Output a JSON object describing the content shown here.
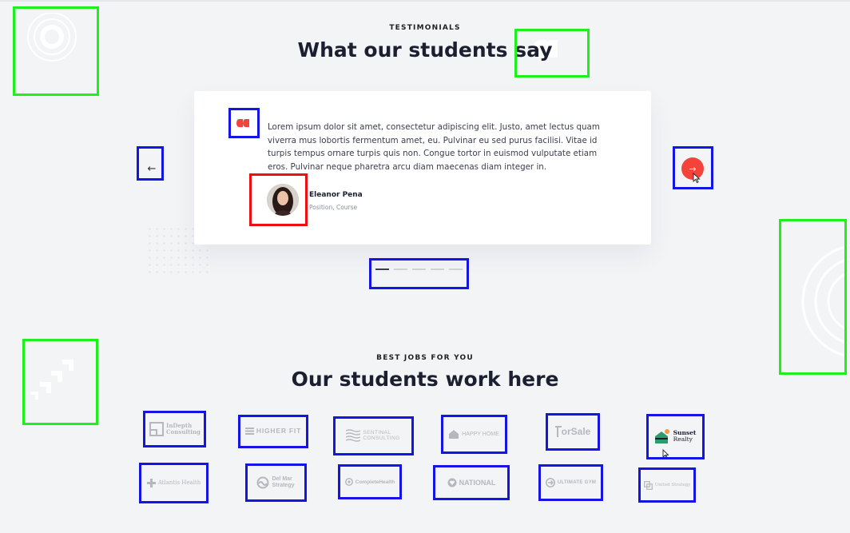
{
  "testimonials": {
    "eyebrow": "TESTIMONIALS",
    "heading": "What our students say",
    "quote": "Lorem ipsum dolor sit amet, consectetur adipiscing elit. Justo, amet lectus quam viverra mus lobortis fermentum amet, eu. Pulvinar eu sed purus facilisi. Vitae id turpis tempus ornare turpis quis non. Congue tortor in euismod vulputate etiam eros. Pulvinar neque pharetra arcu diam maecenas diam integer in.",
    "author_name": "Eleanor Pena",
    "author_role": "Position, Course",
    "prev_glyph": "←",
    "next_glyph": "→",
    "slide_count": 5,
    "active_slide": 1
  },
  "jobs": {
    "eyebrow": "BEST JOBS FOR YOU",
    "heading": "Our students work here",
    "logos": [
      {
        "name": "InDepth Consulting",
        "line1": "InDepth",
        "line2": "Consulting"
      },
      {
        "name": "HIGHER FIT",
        "text": "HIGHER FIT"
      },
      {
        "name": "SENTINAL CONSULTING",
        "line1": "SENTINAL",
        "line2": "CONSULTING"
      },
      {
        "name": "HAPPY HOME",
        "text": "HAPPY HOME"
      },
      {
        "name": "ForSale",
        "text": "orSale"
      },
      {
        "name": "Sunset Realty",
        "line1": "Sunset",
        "line2": "Realty"
      },
      {
        "name": "Atlantis Health",
        "text": "Atlantis Health"
      },
      {
        "name": "Del Mar Strategy",
        "line1": "Del Mar",
        "line2": "Strategy"
      },
      {
        "name": "CompleteHealth",
        "text": "CompleteHealth"
      },
      {
        "name": "NATIONAL",
        "text": "NATIONAL"
      },
      {
        "name": "ULTIMATE GYM",
        "text": "ULTIMATE GYM"
      },
      {
        "name": "United Strategy",
        "text": "United Strategy"
      }
    ]
  },
  "colors": {
    "accent": "#f4433a",
    "background": "#f3f4f6",
    "logo_gray": "#b4b7bd",
    "sunset_green": "#2e9b6f",
    "sunset_orange": "#f2994a"
  }
}
